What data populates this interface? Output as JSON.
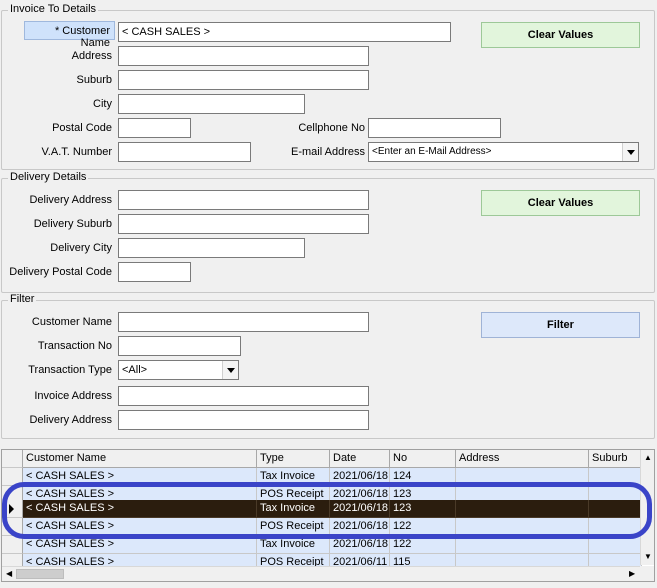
{
  "invoice": {
    "legend": "Invoice To Details",
    "customer_name_label": "* Customer Name",
    "customer_name_value": "< CASH SALES >",
    "address_label": "Address",
    "suburb_label": "Suburb",
    "city_label": "City",
    "postal_code_label": "Postal Code",
    "vat_label": "V.A.T. Number",
    "cellphone_label": "Cellphone No",
    "email_label": "E-mail Address",
    "email_placeholder": "<Enter an E-Mail Address>",
    "clear_label": "Clear Values"
  },
  "delivery": {
    "legend": "Delivery Details",
    "address_label": "Delivery Address",
    "suburb_label": "Delivery Suburb",
    "city_label": "Delivery City",
    "postal_code_label": "Delivery Postal Code",
    "clear_label": "Clear Values"
  },
  "filter": {
    "legend": "Filter",
    "customer_name_label": "Customer Name",
    "transaction_no_label": "Transaction No",
    "transaction_type_label": "Transaction Type",
    "transaction_type_value": "<All>",
    "invoice_address_label": "Invoice Address",
    "delivery_address_label": "Delivery Address",
    "filter_label": "Filter"
  },
  "grid": {
    "columns": [
      "Customer Name",
      "Type",
      "Date",
      "No",
      "Address",
      "Suburb"
    ],
    "rows": [
      {
        "customer": "< CASH SALES >",
        "type": "Tax Invoice",
        "date": "2021/06/18",
        "no": "124",
        "address": "",
        "suburb": ""
      },
      {
        "customer": "< CASH SALES >",
        "type": "POS Receipt",
        "date": "2021/06/18",
        "no": "123",
        "address": "",
        "suburb": ""
      },
      {
        "customer": "< CASH SALES >",
        "type": "Tax Invoice",
        "date": "2021/06/18",
        "no": "123",
        "address": "",
        "suburb": ""
      },
      {
        "customer": "< CASH SALES >",
        "type": "POS Receipt",
        "date": "2021/06/18",
        "no": "122",
        "address": "",
        "suburb": ""
      },
      {
        "customer": "< CASH SALES >",
        "type": "Tax Invoice",
        "date": "2021/06/18",
        "no": "122",
        "address": "",
        "suburb": ""
      },
      {
        "customer": "< CASH SALES >",
        "type": "POS Receipt",
        "date": "2021/06/11",
        "no": "115",
        "address": "",
        "suburb": ""
      }
    ]
  },
  "colors": {
    "highlight_ring": "#3a44c8",
    "selected_row": "#2b1d0e",
    "row_bg": "#dce8fb",
    "clear_button": "#e2f5dc",
    "filter_button": "#dde8fa"
  }
}
